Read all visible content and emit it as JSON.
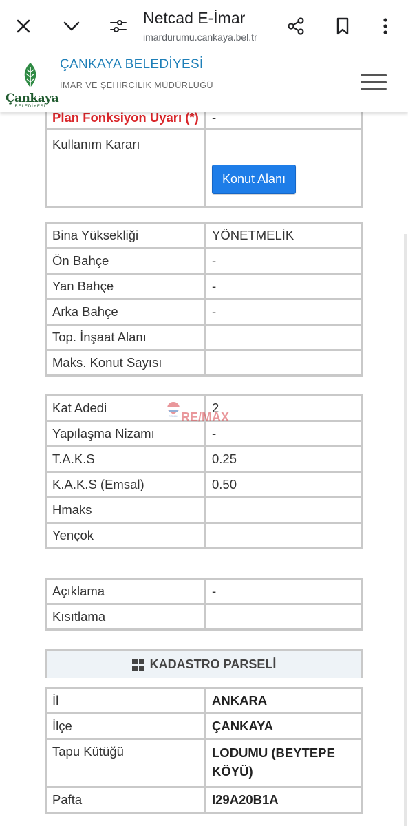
{
  "browser": {
    "title": "Netcad E-İmar",
    "url": "imardurumu.cankaya.bel.tr"
  },
  "site": {
    "logo_word": "Çankaya",
    "logo_sub": "BELEDİYESİ",
    "org_title": "ÇANKAYA BELEDİYESİ",
    "org_sub": "İMAR VE ŞEHİRCİLİK MÜDÜRLÜĞÜ"
  },
  "table1": {
    "clipped_key": "Plan Fonksiyon Uyarı (*)",
    "clipped_value": "-",
    "kullanim_label": "Kullanım Kararı",
    "konut_button": "Konut Alanı"
  },
  "table2": [
    {
      "key": "Bina Yüksekliği",
      "value": "YÖNETMELİK"
    },
    {
      "key": "Ön Bahçe",
      "value": "-"
    },
    {
      "key": "Yan Bahçe",
      "value": "-"
    },
    {
      "key": "Arka Bahçe",
      "value": "-"
    },
    {
      "key": "Top. İnşaat Alanı",
      "value": ""
    },
    {
      "key": "Maks. Konut Sayısı",
      "value": ""
    }
  ],
  "table3": [
    {
      "key": "Kat Adedi",
      "value": "2"
    },
    {
      "key": "Yapılaşma Nizamı",
      "value": "-"
    },
    {
      "key": "T.A.K.S",
      "value": "0.25"
    },
    {
      "key": "K.A.K.S (Emsal)",
      "value": "0.50"
    },
    {
      "key": "Hmaks",
      "value": ""
    },
    {
      "key": "Yençok",
      "value": ""
    }
  ],
  "table4": [
    {
      "key": "Açıklama",
      "value": "-"
    },
    {
      "key": "Kısıtlama",
      "value": ""
    }
  ],
  "kadastro": {
    "header": "KADASTRO PARSELİ",
    "rows": [
      {
        "key": "İl",
        "value": "ANKARA"
      },
      {
        "key": "İlçe",
        "value": "ÇANKAYA"
      },
      {
        "key": "Tapu Kütüğü",
        "value": "LODUMU (BEYTEPE KÖYÜ)"
      },
      {
        "key": "Pafta",
        "value": "I29A20B1A"
      }
    ]
  },
  "watermark": {
    "text": "RE/MAX",
    "small": "REMAX"
  }
}
